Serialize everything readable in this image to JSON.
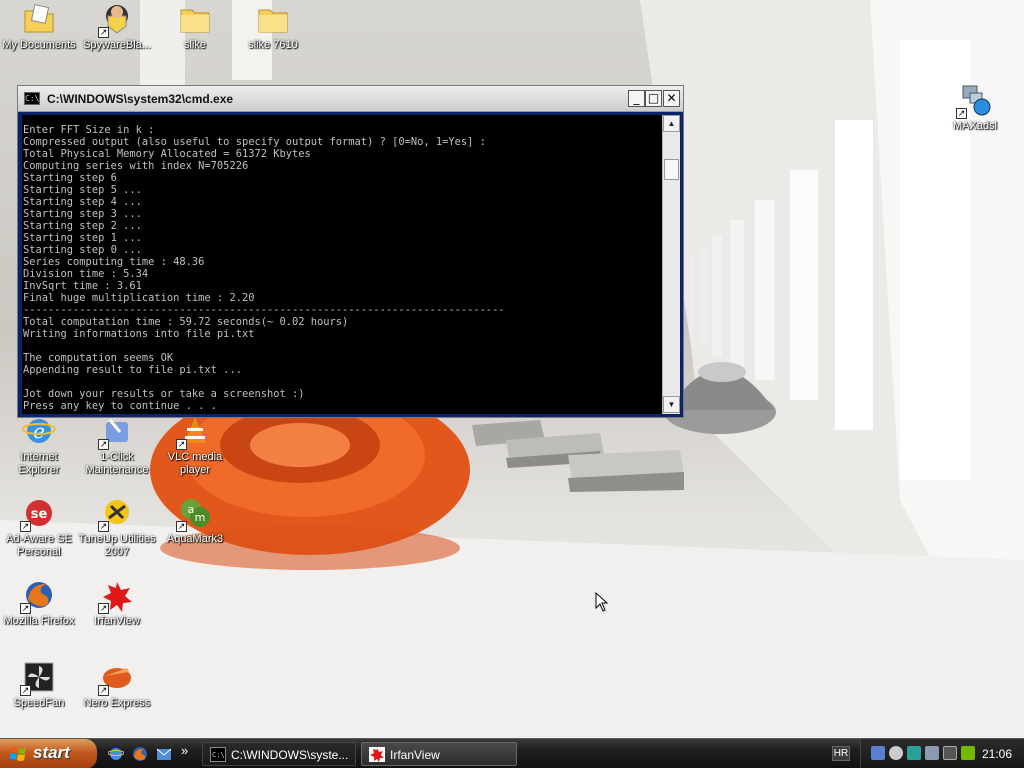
{
  "desktop": {
    "icons": [
      {
        "label": "My Documents",
        "icon": "folder-documents-icon"
      },
      {
        "label": "SpywareBla...",
        "icon": "spywareblaster-icon"
      },
      {
        "label": "slike",
        "icon": "folder-icon"
      },
      {
        "label": "slike 7610",
        "icon": "folder-icon"
      },
      {
        "label": "MAXadsl",
        "icon": "network-icon"
      },
      {
        "label": "Internet Explorer",
        "icon": "internet-explorer-icon"
      },
      {
        "label": "1-Click Maintenance",
        "icon": "maintenance-icon"
      },
      {
        "label": "VLC media player",
        "icon": "vlc-icon"
      },
      {
        "label": "Ad-Aware SE Personal",
        "icon": "ad-aware-icon"
      },
      {
        "label": "TuneUp Utilities 2007",
        "icon": "tuneup-icon"
      },
      {
        "label": "AquaMark3",
        "icon": "aquamark-icon"
      },
      {
        "label": "Mozilla Firefox",
        "icon": "firefox-icon"
      },
      {
        "label": "IrfanView",
        "icon": "irfanview-icon"
      },
      {
        "label": "SpeedFan",
        "icon": "speedfan-icon"
      },
      {
        "label": "Nero Express",
        "icon": "nero-icon"
      }
    ]
  },
  "cmd_window": {
    "title": "C:\\WINDOWS\\system32\\cmd.exe",
    "icon_text": "C:\\",
    "minimize_label": "_",
    "maximize_label": "□",
    "close_label": "✕",
    "scroll_up": "▲",
    "scroll_down": "▼",
    "lines": [
      "Enter FFT Size in k :",
      "Compressed output (also useful to specify output format) ? [0=No, 1=Yes] :",
      "Total Physical Memory Allocated = 61372 Kbytes",
      "Computing series with index N=705226",
      "Starting step 6",
      "Starting step 5 ...",
      "Starting step 4 ...",
      "Starting step 3 ...",
      "Starting step 2 ...",
      "Starting step 1 ...",
      "Starting step 0 ...",
      "Series computing time : 48.36",
      "Division time : 5.34",
      "InvSqrt time : 3.61",
      "Final huge multiplication time : 2.20",
      "-----------------------------------------------------------------------------",
      "Total computation time : 59.72 seconds(~ 0.02 hours)",
      "Writing informations into file pi.txt",
      "",
      "The computation seems OK",
      "Appending result to file pi.txt ...",
      "",
      "Jot down your results or take a screenshot :)",
      "Press any key to continue . . ."
    ]
  },
  "taskbar": {
    "start_label": "start",
    "quicklaunch": [
      "internet-explorer-icon",
      "firefox-icon",
      "outlook-icon"
    ],
    "quicklaunch_more": "»",
    "tasks": [
      {
        "label": "C:\\WINDOWS\\syste...",
        "icon": "cmd-icon",
        "active": true
      },
      {
        "label": "IrfanView",
        "icon": "irfanview-icon",
        "active": false
      }
    ],
    "language": "HR",
    "tray_icons": [
      "network-tray-icon",
      "antivirus-tray-icon",
      "speedfan-tray-icon",
      "volume-tray-icon",
      "update-tray-icon",
      "nvidia-tray-icon"
    ],
    "clock": "21:06"
  },
  "colors": {
    "console_text": "#c0c0c0",
    "console_bg": "#000000",
    "start_orange": "#c2581e"
  }
}
